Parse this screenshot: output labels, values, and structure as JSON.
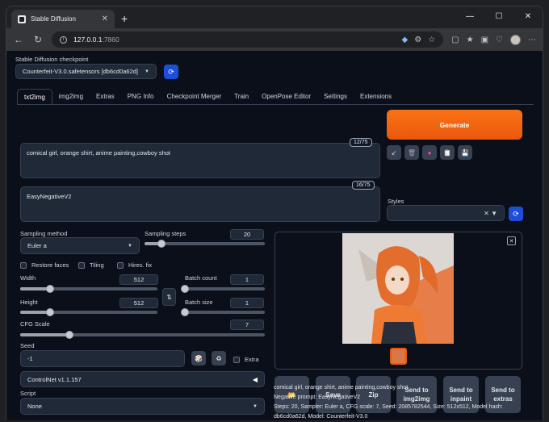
{
  "browser": {
    "tab_title": "Stable Diffusion",
    "tab_close": "✕",
    "new_tab": "+",
    "url_host": "127.0.0.1",
    "url_port": ":7860",
    "controls": {
      "minimize": "—",
      "maximize": "☐",
      "close": "✕"
    }
  },
  "checkpoint": {
    "label": "Stable Diffusion checkpoint",
    "value": "Counterfeit-V3.0.safetensors [db6cd0a62d]"
  },
  "tabs": [
    "txt2img",
    "img2img",
    "Extras",
    "PNG Info",
    "Checkpoint Merger",
    "Train",
    "OpenPose Editor",
    "Settings",
    "Extensions"
  ],
  "prompt": {
    "text": "comical girl, orange shirt, anime painting,cowboy shot",
    "tokens": "12/75"
  },
  "negative_prompt": {
    "text": "EasyNegativeV2",
    "tokens": "16/75"
  },
  "generate_label": "Generate",
  "styles_label": "Styles",
  "sampling": {
    "method_label": "Sampling method",
    "method_value": "Euler a",
    "steps_label": "Sampling steps",
    "steps_value": "20",
    "steps_fraction": 0.14
  },
  "checkboxes": [
    "Restore faces",
    "Tiling",
    "Hires. fix"
  ],
  "width": {
    "label": "Width",
    "value": "512",
    "fraction": 0.22
  },
  "height": {
    "label": "Height",
    "value": "512",
    "fraction": 0.22
  },
  "batch_count": {
    "label": "Batch count",
    "value": "1",
    "fraction": 0.0
  },
  "batch_size": {
    "label": "Batch size",
    "value": "1",
    "fraction": 0.0
  },
  "cfg": {
    "label": "CFG Scale",
    "value": "7",
    "fraction": 0.2
  },
  "seed": {
    "label": "Seed",
    "value": "-1",
    "extra_label": "Extra"
  },
  "controlnet_label": "ControlNet v1.1.157",
  "script": {
    "label": "Script",
    "value": "None"
  },
  "actions": [
    "Save",
    "Zip",
    "Send to img2img",
    "Send to inpaint",
    "Send to extras"
  ],
  "output_info": {
    "prompt": "comical girl, orange shirt, anime painting,cowboy shot",
    "negative": "Negative prompt: EasyNegativeV2",
    "params": "Steps: 20, Sampler: Euler a, CFG scale: 7, Seed: 2085782544, Size: 512x512, Model hash:",
    "params2": "db6cd0a62d, Model: Counterfeit-V3.0"
  },
  "colors": {
    "accent": "#ea580c",
    "primary": "#1d4ed8",
    "bg": "#0b0f19"
  }
}
